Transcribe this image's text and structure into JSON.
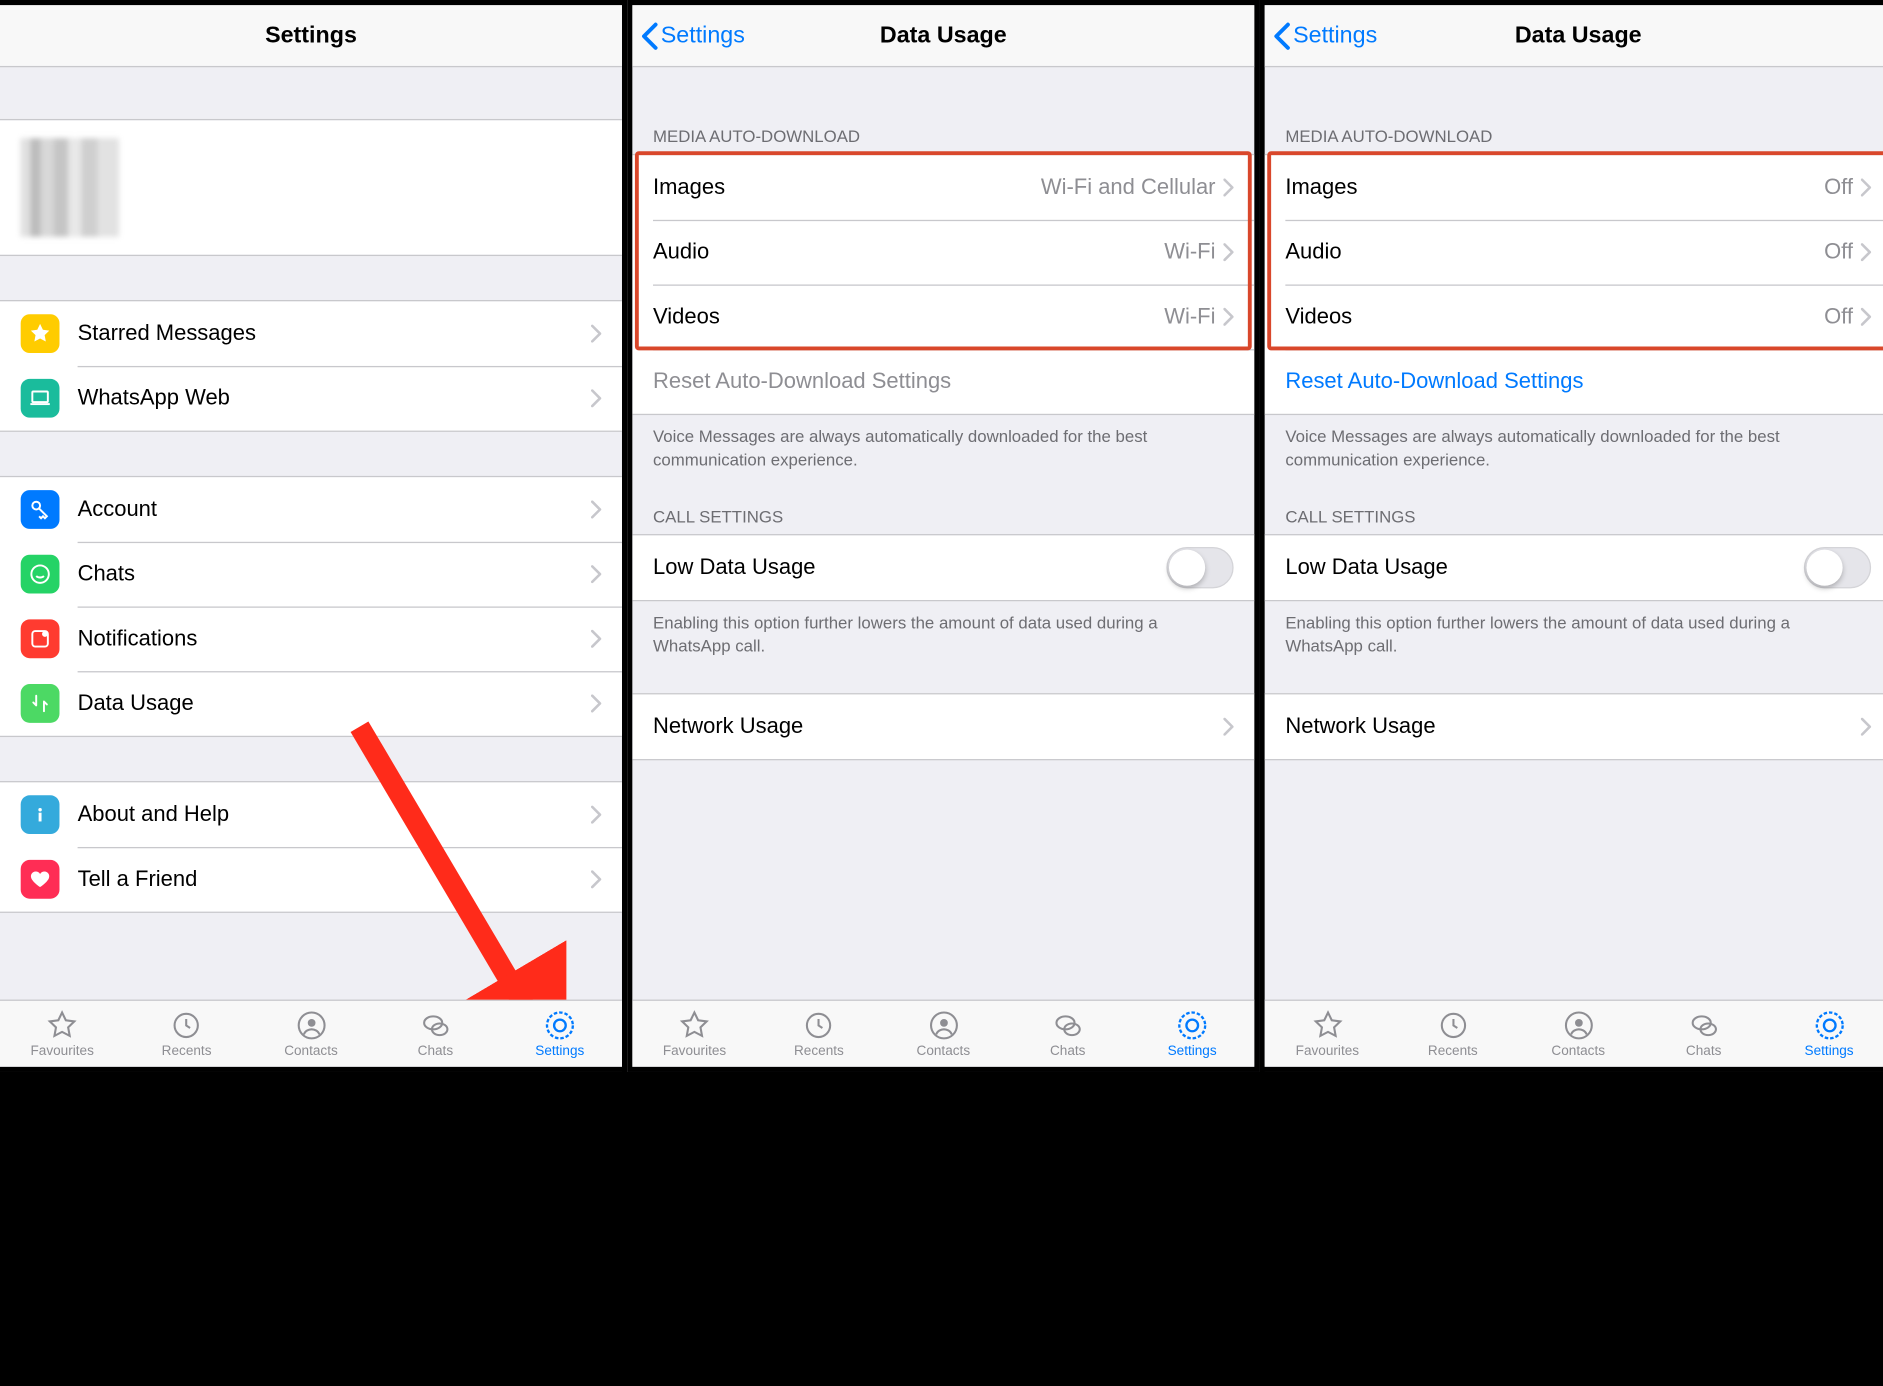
{
  "scale": 1.2931,
  "tabs": {
    "favourites": "Favourites",
    "recents": "Recents",
    "contacts": "Contacts",
    "chats": "Chats",
    "settings": "Settings"
  },
  "screen1": {
    "title": "Settings",
    "groups": {
      "shortcuts": {
        "starred": "Starred Messages",
        "web": "WhatsApp Web"
      },
      "main": {
        "account": "Account",
        "chats": "Chats",
        "notifications": "Notifications",
        "data_usage": "Data Usage"
      },
      "misc": {
        "about": "About and Help",
        "tell": "Tell a Friend"
      }
    }
  },
  "screen2": {
    "back": "Settings",
    "title": "Data Usage",
    "media_header": "MEDIA AUTO-DOWNLOAD",
    "media": {
      "images": {
        "label": "Images",
        "value": "Wi-Fi and Cellular"
      },
      "audio": {
        "label": "Audio",
        "value": "Wi-Fi"
      },
      "videos": {
        "label": "Videos",
        "value": "Wi-Fi"
      }
    },
    "reset": "Reset Auto-Download Settings",
    "reset_enabled": false,
    "media_footer": "Voice Messages are always automatically downloaded for the best communication experience.",
    "call_header": "CALL SETTINGS",
    "low_data": "Low Data Usage",
    "call_footer": "Enabling this option further lowers the amount of data used during a WhatsApp call.",
    "network": "Network Usage"
  },
  "screen3": {
    "back": "Settings",
    "title": "Data Usage",
    "media_header": "MEDIA AUTO-DOWNLOAD",
    "media": {
      "images": {
        "label": "Images",
        "value": "Off"
      },
      "audio": {
        "label": "Audio",
        "value": "Off"
      },
      "videos": {
        "label": "Videos",
        "value": "Off"
      }
    },
    "reset": "Reset Auto-Download Settings",
    "reset_enabled": true,
    "media_footer": "Voice Messages are always automatically downloaded for the best communication experience.",
    "call_header": "CALL SETTINGS",
    "low_data": "Low Data Usage",
    "call_footer": "Enabling this option further lowers the amount of data used during a WhatsApp call.",
    "network": "Network Usage"
  }
}
